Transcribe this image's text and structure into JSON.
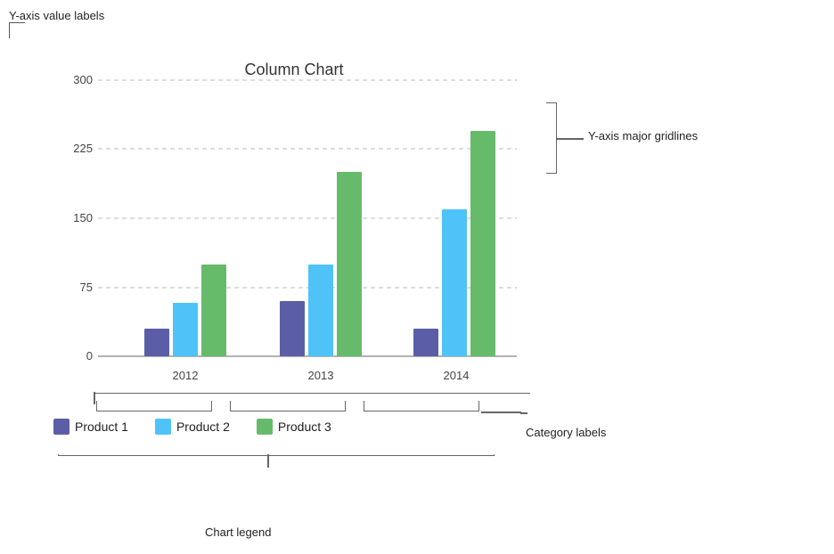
{
  "chart": {
    "title": "Column Chart",
    "yAxis": {
      "label": "Y-axis value labels",
      "values": [
        300,
        225,
        150,
        75,
        0
      ],
      "max": 300
    },
    "xAxis": {
      "categories": [
        "2012",
        "2013",
        "2014"
      ]
    },
    "series": [
      {
        "name": "Product 1",
        "color": "#5b5ea6",
        "values": [
          30,
          60,
          30
        ]
      },
      {
        "name": "Product 2",
        "color": "#4fc3f7",
        "values": [
          58,
          100,
          160
        ]
      },
      {
        "name": "Product 3",
        "color": "#66bb6a",
        "values": [
          100,
          200,
          245
        ]
      }
    ],
    "annotations": {
      "yAxisLabel": "Y-axis value labels",
      "yAxisGridlines": "Y-axis major gridlines",
      "categoryLabels": "Category labels",
      "chartLegend": "Chart legend"
    }
  }
}
